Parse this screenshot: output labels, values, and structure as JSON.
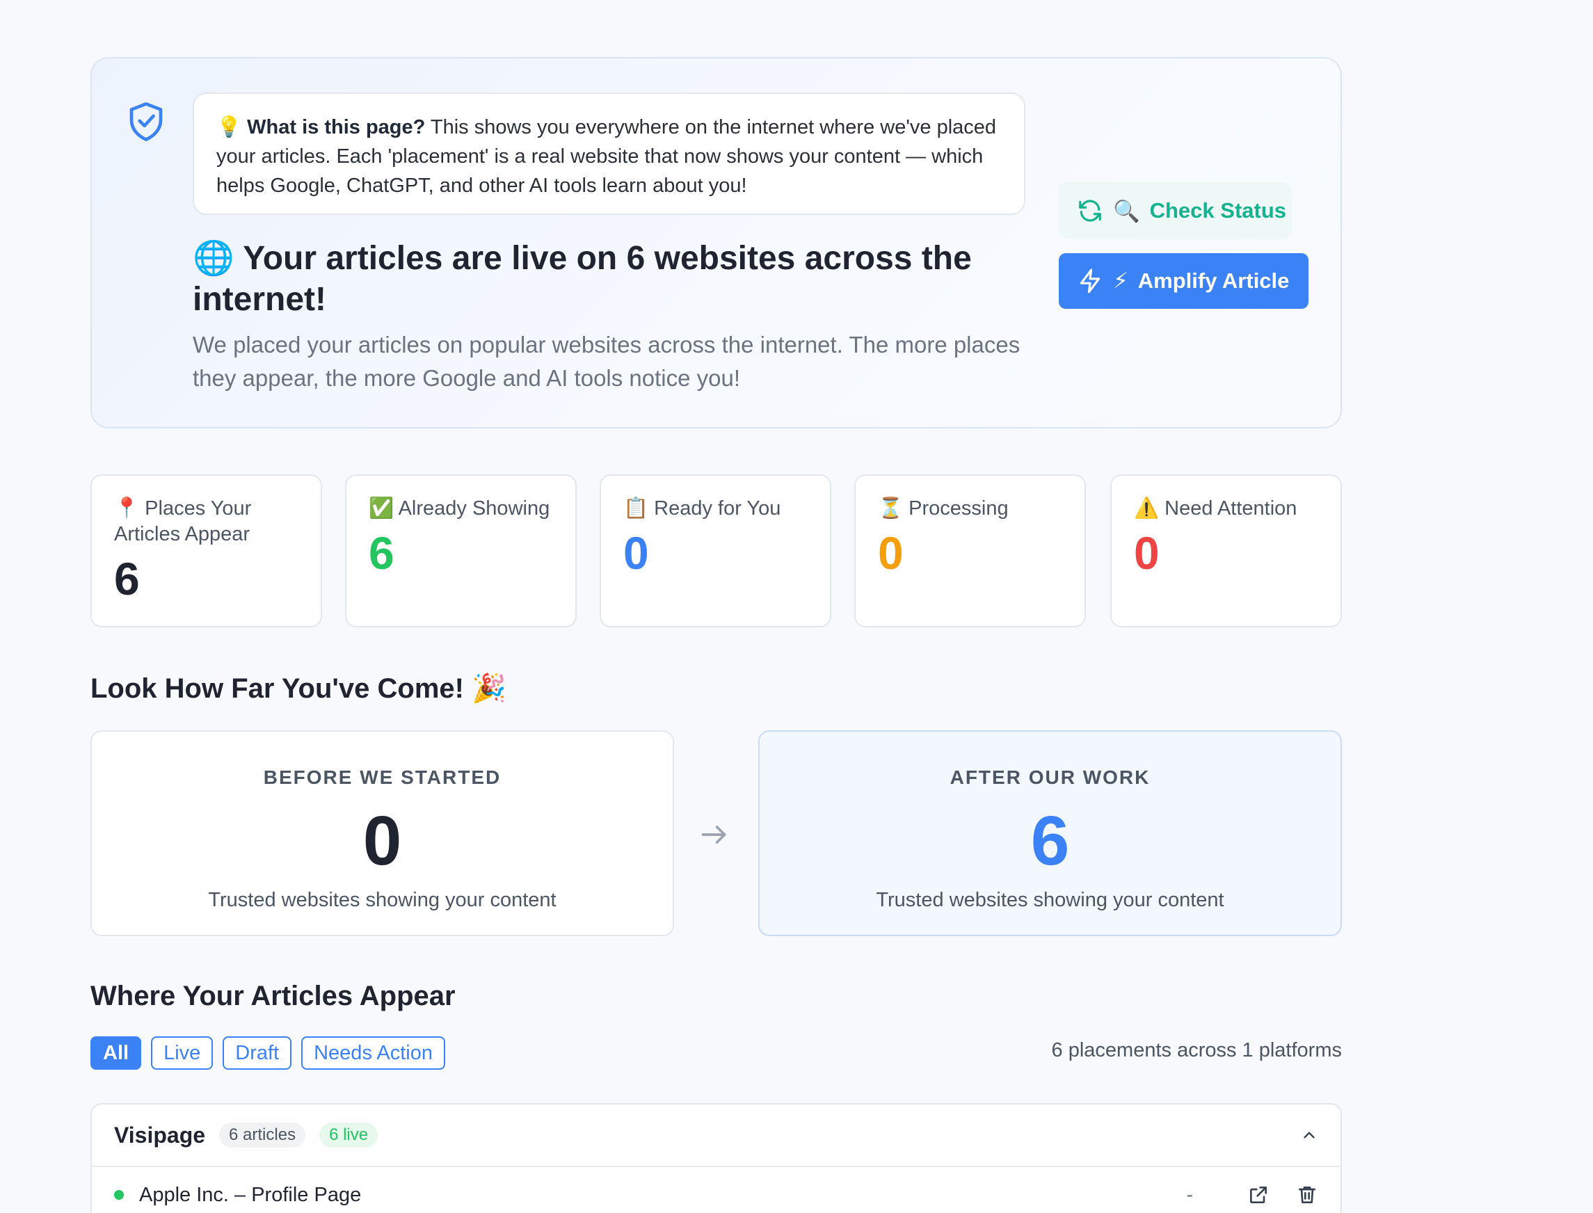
{
  "hero": {
    "info_emoji": "💡",
    "info_bold": "What is this page?",
    "info_text": " This shows you everywhere on the internet where we've placed your articles. Each 'placement' is a real website that now shows your content — which helps Google, ChatGPT, and other AI tools learn about you!",
    "title_emoji": "🌐",
    "title": "Your articles are live on 6 websites across the internet!",
    "subtitle": "We placed your articles on popular websites across the internet. The more places they appear, the more Google and AI tools notice you!",
    "check_emoji": "🔍",
    "check_label": "Check Status",
    "amplify_emoji": "⚡",
    "amplify_label": "Amplify Article"
  },
  "stats": [
    {
      "emoji": "📍",
      "label": "Places Your Articles Appear",
      "value": "6",
      "color": "#1f2430"
    },
    {
      "emoji": "✅",
      "label": "Already Showing",
      "value": "6",
      "color": "#22c55e"
    },
    {
      "emoji": "📋",
      "label": "Ready for You",
      "value": "0",
      "color": "#3b82f6"
    },
    {
      "emoji": "⏳",
      "label": "Processing",
      "value": "0",
      "color": "#f59e0b"
    },
    {
      "emoji": "⚠️",
      "label": "Need Attention",
      "value": "0",
      "color": "#ef4444"
    }
  ],
  "progress": {
    "title": "Look How Far You've Come!",
    "title_emoji": "🎉",
    "before": {
      "caption": "BEFORE WE STARTED",
      "value": "0",
      "desc": "Trusted websites showing your content",
      "color": "#1f2430"
    },
    "after": {
      "caption": "AFTER OUR WORK",
      "value": "6",
      "desc": "Trusted websites showing your content",
      "color": "#3b82f6"
    }
  },
  "placements": {
    "title": "Where Your Articles Appear",
    "filters": [
      "All",
      "Live",
      "Draft",
      "Needs Action"
    ],
    "active_filter": "All",
    "summary": "6 placements across 1 platforms",
    "platform": {
      "name": "Visipage",
      "articles_badge": "6 articles",
      "live_badge": "6 live",
      "rows": [
        {
          "title": "Apple Inc. – Profile Page",
          "value": "-"
        }
      ]
    }
  },
  "colors": {
    "accent": "#3b82f6",
    "success": "#22c55e",
    "teal": "#14b28f"
  }
}
